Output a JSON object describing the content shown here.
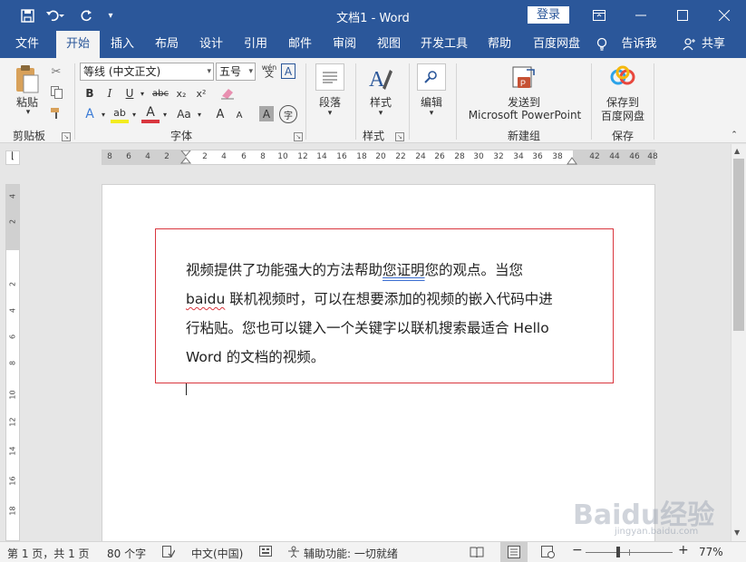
{
  "app": {
    "window_title": "文档1  -  Word",
    "login_label": "登录"
  },
  "quick_access": {
    "save_icon": "save-icon",
    "undo_icon": "undo-icon",
    "redo_icon": "redo-icon",
    "customize_icon": "customize-qat-icon"
  },
  "window_controls": {
    "ribbon_display_icon": "ribbon-display-icon",
    "minimize_icon": "minimize-icon",
    "maximize_icon": "maximize-icon",
    "close_icon": "close-icon"
  },
  "tabs": [
    {
      "label": "文件"
    },
    {
      "label": "开始"
    },
    {
      "label": "插入"
    },
    {
      "label": "布局"
    },
    {
      "label": "设计"
    },
    {
      "label": "引用"
    },
    {
      "label": "邮件"
    },
    {
      "label": "审阅"
    },
    {
      "label": "视图"
    },
    {
      "label": "开发工具"
    },
    {
      "label": "帮助"
    },
    {
      "label": "百度网盘"
    },
    {
      "label": "告诉我"
    },
    {
      "label": "共享"
    }
  ],
  "ribbon": {
    "clipboard": {
      "paste_label": "粘贴",
      "group_label": "剪贴板"
    },
    "font": {
      "font_name": "等线 (中文正文)",
      "font_size": "五号",
      "bold": "B",
      "italic": "I",
      "underline": "U",
      "strikethrough": "abc",
      "subscript": "x₂",
      "superscript": "x²",
      "text_effect": "A",
      "highlight": "ab",
      "font_color": "A",
      "change_case": "Aa",
      "grow": "A",
      "shrink": "A",
      "char_shading": "A",
      "enclose": "字",
      "phonetic": "wén",
      "char_border": "A",
      "group_label": "字体"
    },
    "paragraph": {
      "label": "段落"
    },
    "styles": {
      "label": "样式",
      "group_label": "样式"
    },
    "editing": {
      "label": "编辑"
    },
    "new_group": {
      "line1": "发送到",
      "line2": "Microsoft PowerPoint",
      "group_label": "新建组"
    },
    "save": {
      "line1": "保存到",
      "line2": "百度网盘",
      "group_label": "保存"
    }
  },
  "ruler": {
    "h_left_numbers": [
      "8",
      "6",
      "4",
      "2"
    ],
    "h_numbers": [
      "2",
      "4",
      "6",
      "8",
      "10",
      "12",
      "14",
      "16",
      "18",
      "20",
      "22",
      "24",
      "26",
      "28",
      "30",
      "32",
      "34",
      "36",
      "38"
    ],
    "h_right_numbers": [
      "42",
      "44",
      "46",
      "48"
    ],
    "v_numbers": [
      "4",
      "2",
      "2",
      "4",
      "6",
      "8",
      "10",
      "12",
      "14",
      "16",
      "18"
    ]
  },
  "document": {
    "line1_a": "视频提供了功能强大的方法帮助",
    "line1_b": "您证明",
    "line1_c": "您的观点。当您",
    "line2_a": "baidu",
    "line2_b": " 联机视频时，可以在想要添加的视频的嵌入代码中进",
    "line3": "行粘贴。您也可以键入一个关键字以联机搜索最适合 Hello",
    "line4": "Word 的文档的视频。"
  },
  "statusbar": {
    "page": "第 1 页，共 1 页",
    "words": "80 个字",
    "language": "中文(中国)",
    "accessibility": "辅助功能: 一切就绪",
    "zoom": "77%"
  },
  "watermark": {
    "text": "Baidu经验",
    "sub": "jingyan.baidu.com"
  },
  "colors": {
    "word_blue": "#2b579a",
    "textbox_border": "#d9363e",
    "ribbon_bg": "#f3f3f3"
  },
  "zoom_percent": 77
}
